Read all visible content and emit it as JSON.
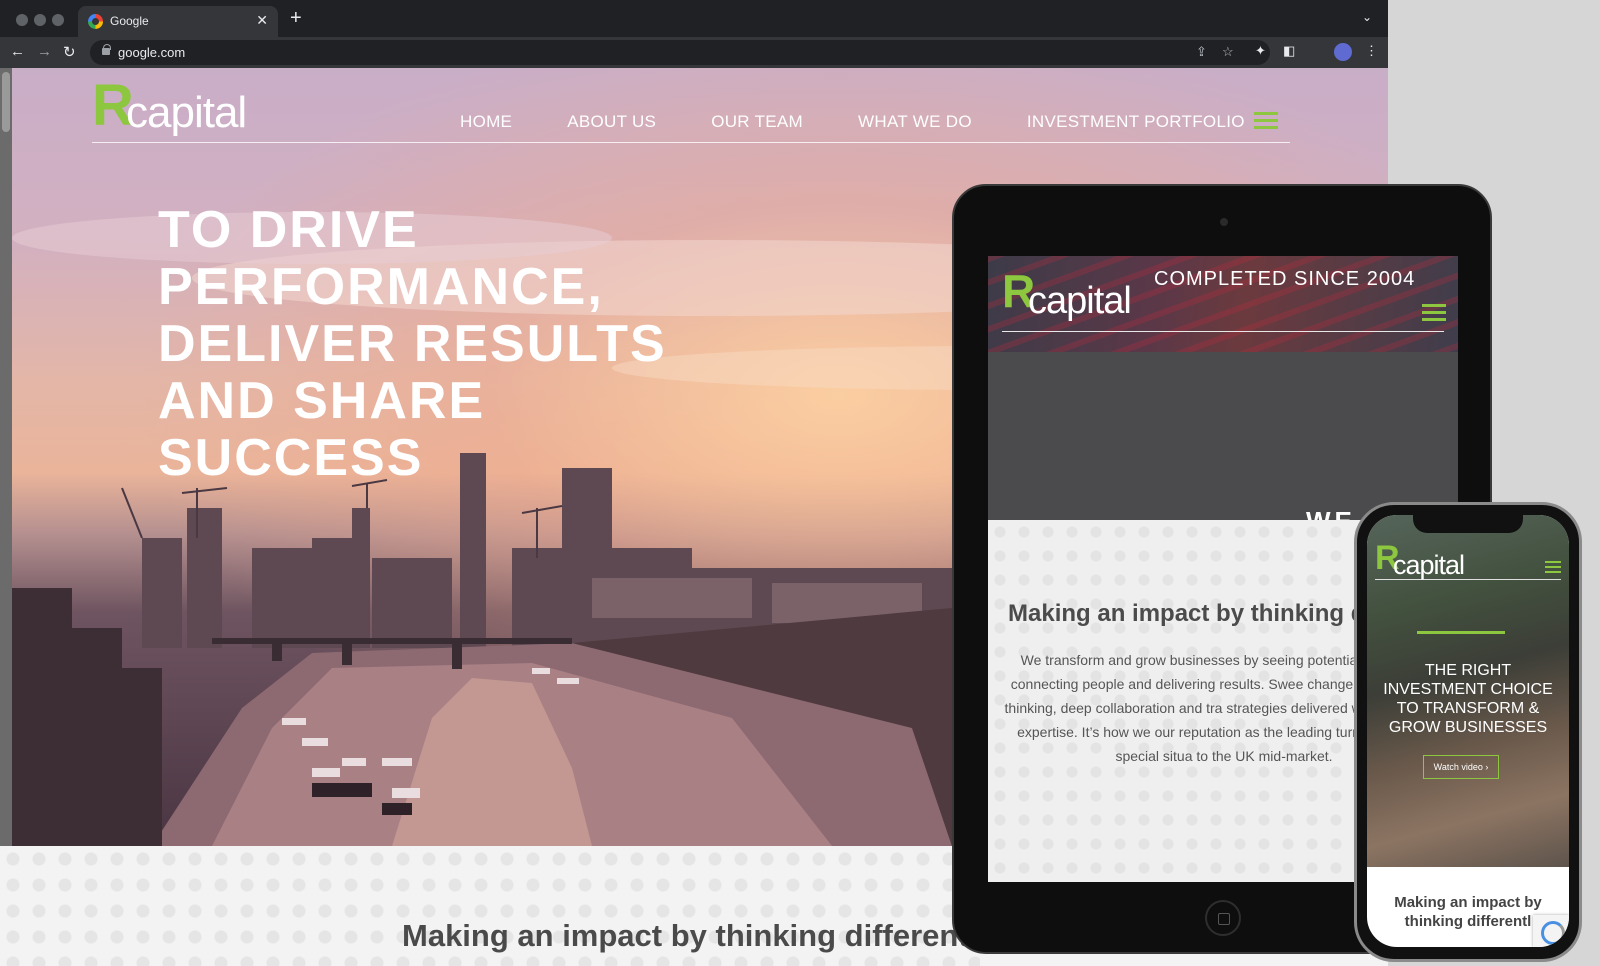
{
  "browser": {
    "tab_title": "Google",
    "tab_close": "✕",
    "new_tab": "+",
    "tab_menu": "⌄",
    "url": "google.com",
    "back": "←",
    "forward": "→",
    "reload": "↻"
  },
  "site": {
    "logo_letter": "R",
    "logo_text": "capital",
    "nav": [
      "HOME",
      "ABOUT US",
      "OUR TEAM",
      "WHAT WE DO",
      "INVESTMENT PORTFOLIO"
    ],
    "headline": [
      "TO DRIVE",
      "PERFORMANCE,",
      "DELIVER RESULTS",
      "AND SHARE",
      "SUCCESS"
    ],
    "section_heading": "Making an impact by thinking differently"
  },
  "tablet": {
    "completed": "COMPLETED SINCE 2004",
    "we_text": "WE",
    "heading": "Making an impact by thinking dif",
    "paragraph": "We transform and grow businesses by seeing potential situations, connecting people and delivering results. Swee change requires new thinking, deep collaboration and tra strategies delivered with rigour and expertise. It’s how we our reputation as the leading turnaround and special situa to the UK mid-market."
  },
  "phone": {
    "tagline": "THE RIGHT INVESTMENT CHOICE TO TRANSFORM & GROW BUSINESSES",
    "watch_video": "Watch video ›",
    "heading": "Making an impact by thinking differentl"
  },
  "colors": {
    "brand_green": "#8dc63f",
    "chrome_dark": "#202124",
    "chrome_toolbar": "#35363a"
  },
  "icons": [
    "google-favicon-icon",
    "lock-icon",
    "share-icon",
    "star-icon",
    "extensions-icon",
    "sidepanel-icon",
    "kebab-menu-icon",
    "hamburger-icon",
    "home-button-icon",
    "recaptcha-icon"
  ]
}
